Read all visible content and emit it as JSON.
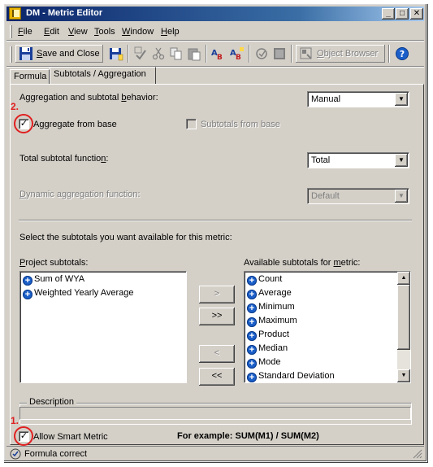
{
  "window": {
    "title": "DM - Metric Editor"
  },
  "menu": [
    {
      "label": "File",
      "key": "F",
      "rest": "ile"
    },
    {
      "label": "Edit",
      "key": "E",
      "rest": "dit"
    },
    {
      "label": "View",
      "key": "V",
      "rest": "iew"
    },
    {
      "label": "Tools",
      "key": "T",
      "rest": "ools"
    },
    {
      "label": "Window",
      "key": "W",
      "rest": "indow"
    },
    {
      "label": "Help",
      "key": "H",
      "rest": "elp"
    }
  ],
  "toolbar": {
    "save_close_key": "S",
    "save_close_rest": "ave and Close",
    "object_browser_key": "O",
    "object_browser_rest": "bject Browser"
  },
  "tabs": [
    {
      "label": "Formula",
      "active": false
    },
    {
      "label": "Subtotals / Aggregation",
      "active": true
    }
  ],
  "aggregation": {
    "behavior_label_pre": "Aggregation and subtotal ",
    "behavior_label_key": "b",
    "behavior_label_post": "ehavior:",
    "behavior_value": "Manual",
    "aggregate_from_base_label": "Aggregate from base",
    "aggregate_from_base_checked": true,
    "subtotals_from_base_label": "Subtotals from base",
    "subtotals_from_base_checked": false,
    "total_subtotal_label_pre": "Total subtotal functio",
    "total_subtotal_label_key": "n",
    "total_subtotal_label_post": ":",
    "total_subtotal_value": "Total",
    "dynamic_label_key": "D",
    "dynamic_label_rest": "ynamic aggregation function:",
    "dynamic_value": "Default"
  },
  "subtotals": {
    "instruction": "Select the subtotals you want available for this metric:",
    "project_label_key": "P",
    "project_label_rest": "roject subtotals:",
    "project_items": [
      "Sum of WYA",
      "Weighted Yearly Average"
    ],
    "available_label_pre": "Available subtotals for ",
    "available_label_key": "m",
    "available_label_post": "etric:",
    "available_items": [
      "Count",
      "Average",
      "Minimum",
      "Maximum",
      "Product",
      "Median",
      "Mode",
      "Standard Deviation"
    ],
    "btn_add": ">",
    "btn_add_all": ">>",
    "btn_remove": "<",
    "btn_remove_all": "<<"
  },
  "description": {
    "legend": "Description",
    "value": ""
  },
  "smart_metric": {
    "label": "Allow Smart Metric",
    "checked": true,
    "example": "For example: SUM(M1) / SUM(M2)"
  },
  "annotations": [
    "1.",
    "2."
  ],
  "status": {
    "text": "Formula correct"
  },
  "colors": {
    "title_start": "#0a246a",
    "title_end": "#a6caf0",
    "annotation": "#e02020",
    "icon_plus": "#1b5fc9"
  }
}
